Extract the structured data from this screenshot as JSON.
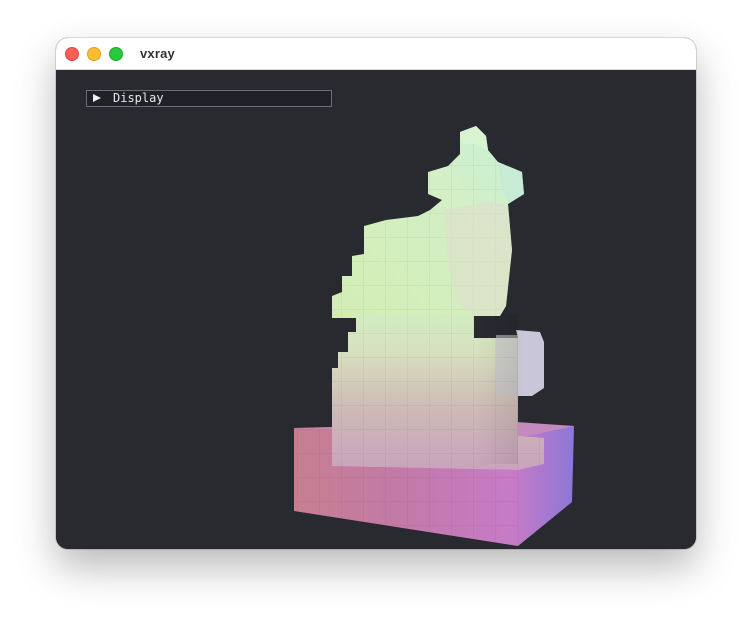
{
  "window": {
    "title": "vxray"
  },
  "panel": {
    "label": "Display",
    "expanded": false
  },
  "model": {
    "description_icon": "voxel-chess-knight"
  }
}
